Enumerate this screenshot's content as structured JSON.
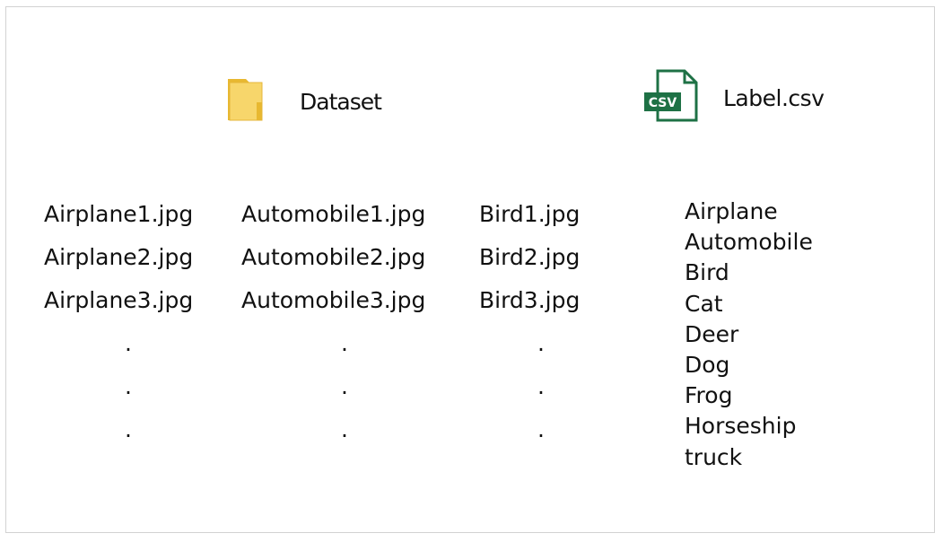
{
  "dataset": {
    "folder_label": "Dataset",
    "folder_icon": "folder-icon",
    "folder_color": "#F5C842"
  },
  "label_file": {
    "name": "Label.csv",
    "icon": "csv-file-icon",
    "icon_badge": "CSV",
    "icon_color": "#1E7145"
  },
  "file_columns": [
    {
      "files": [
        "Airplane1.jpg",
        "Airplane2.jpg",
        "Airplane3.jpg"
      ],
      "continuation": ".",
      "continuation_count": 3
    },
    {
      "files": [
        "Automobile1.jpg",
        "Automobile2.jpg",
        "Automobile3.jpg"
      ],
      "continuation": ".",
      "continuation_count": 3
    },
    {
      "files": [
        "Bird1.jpg",
        "Bird2.jpg",
        "Bird3.jpg"
      ],
      "continuation": ".",
      "continuation_count": 3
    }
  ],
  "labels": [
    "Airplane",
    "Automobile",
    "Bird",
    "Cat",
    "Deer",
    "Dog",
    "Frog",
    "Horseship",
    "truck"
  ]
}
